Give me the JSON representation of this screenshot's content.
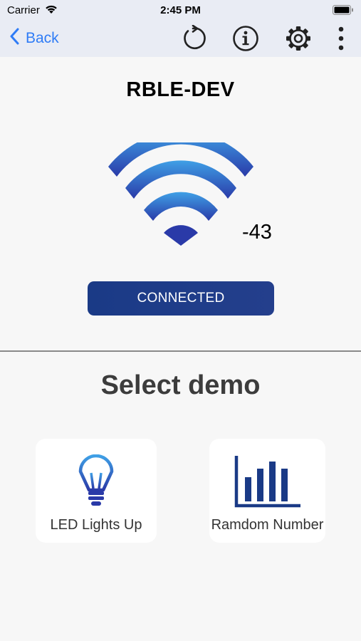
{
  "status_bar": {
    "carrier": "Carrier",
    "time": "2:45 PM",
    "wifi_icon": "wifi-icon",
    "battery_icon": "battery-icon"
  },
  "nav": {
    "back_label": "Back",
    "icons": [
      "refresh-icon",
      "info-icon",
      "gear-icon",
      "more-vertical-icon"
    ]
  },
  "device": {
    "name": "RBLE-DEV",
    "rssi": "-43",
    "connection_button": "CONNECTED"
  },
  "demos": {
    "title": "Select demo",
    "items": [
      {
        "label": "LED Lights Up",
        "icon": "lightbulb-icon"
      },
      {
        "label": "Ramdom Number",
        "icon": "bar-chart-icon"
      }
    ]
  },
  "colors": {
    "accent": "#2f7cf6",
    "button_dark_blue": "#1a3a86",
    "nav_background": "#e9ecf4",
    "page_background": "#f7f7f7",
    "signal_light": "#3fa0e6",
    "signal_dark": "#2a3aa8"
  }
}
